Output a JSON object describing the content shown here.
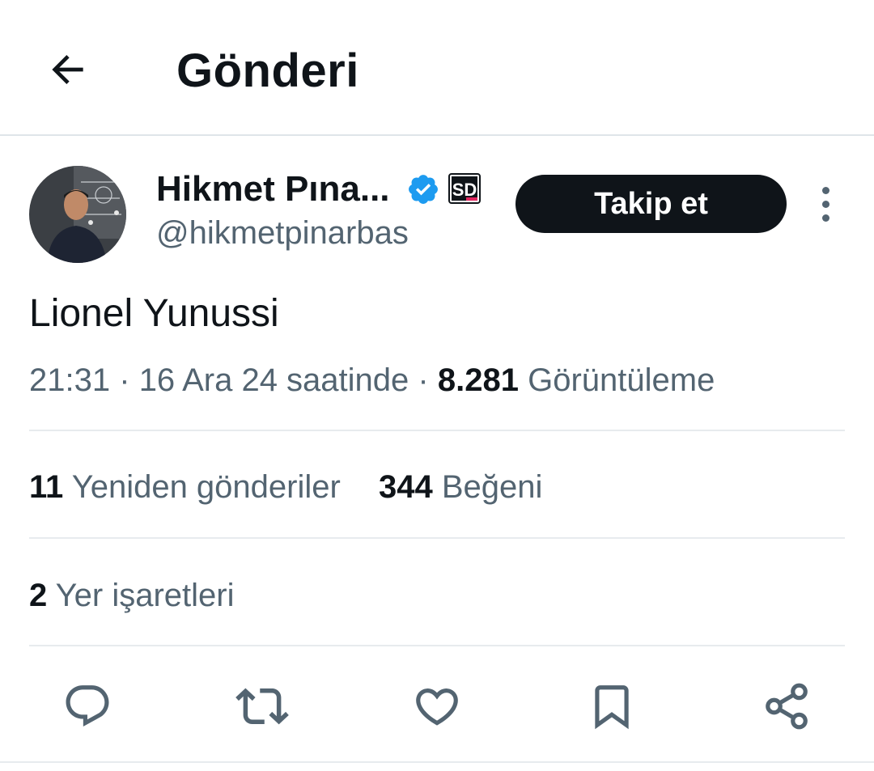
{
  "header": {
    "title": "Gönderi",
    "back_icon": "arrow-left-icon"
  },
  "author": {
    "display_name": "Hikmet Pına...",
    "handle": "@hikmetpinarbas",
    "verified_icon": "verified-badge-icon",
    "org_badge_text": "SD",
    "follow_label": "Takip et",
    "more_icon": "more-vertical-icon"
  },
  "tweet": {
    "text": "Lionel Yunussi",
    "time": "21:31",
    "sep1": "·",
    "date": "16 Ara 24 saatinde",
    "sep2": "·",
    "views_count": "8.281",
    "views_label": "Görüntüleme"
  },
  "stats": {
    "reposts_count": "11",
    "reposts_label": "Yeniden gönderiler",
    "likes_count": "344",
    "likes_label": "Beğeni",
    "bookmarks_count": "2",
    "bookmarks_label": "Yer işaretleri"
  },
  "actions": {
    "reply_icon": "reply-icon",
    "repost_icon": "repost-icon",
    "like_icon": "heart-icon",
    "bookmark_icon": "bookmark-icon",
    "share_icon": "share-icon"
  },
  "colors": {
    "primary_text": "#0f1419",
    "secondary_text": "#536471",
    "divider": "#e7ebee",
    "verified_blue": "#1d9bf0",
    "button_bg": "#0f1419"
  }
}
